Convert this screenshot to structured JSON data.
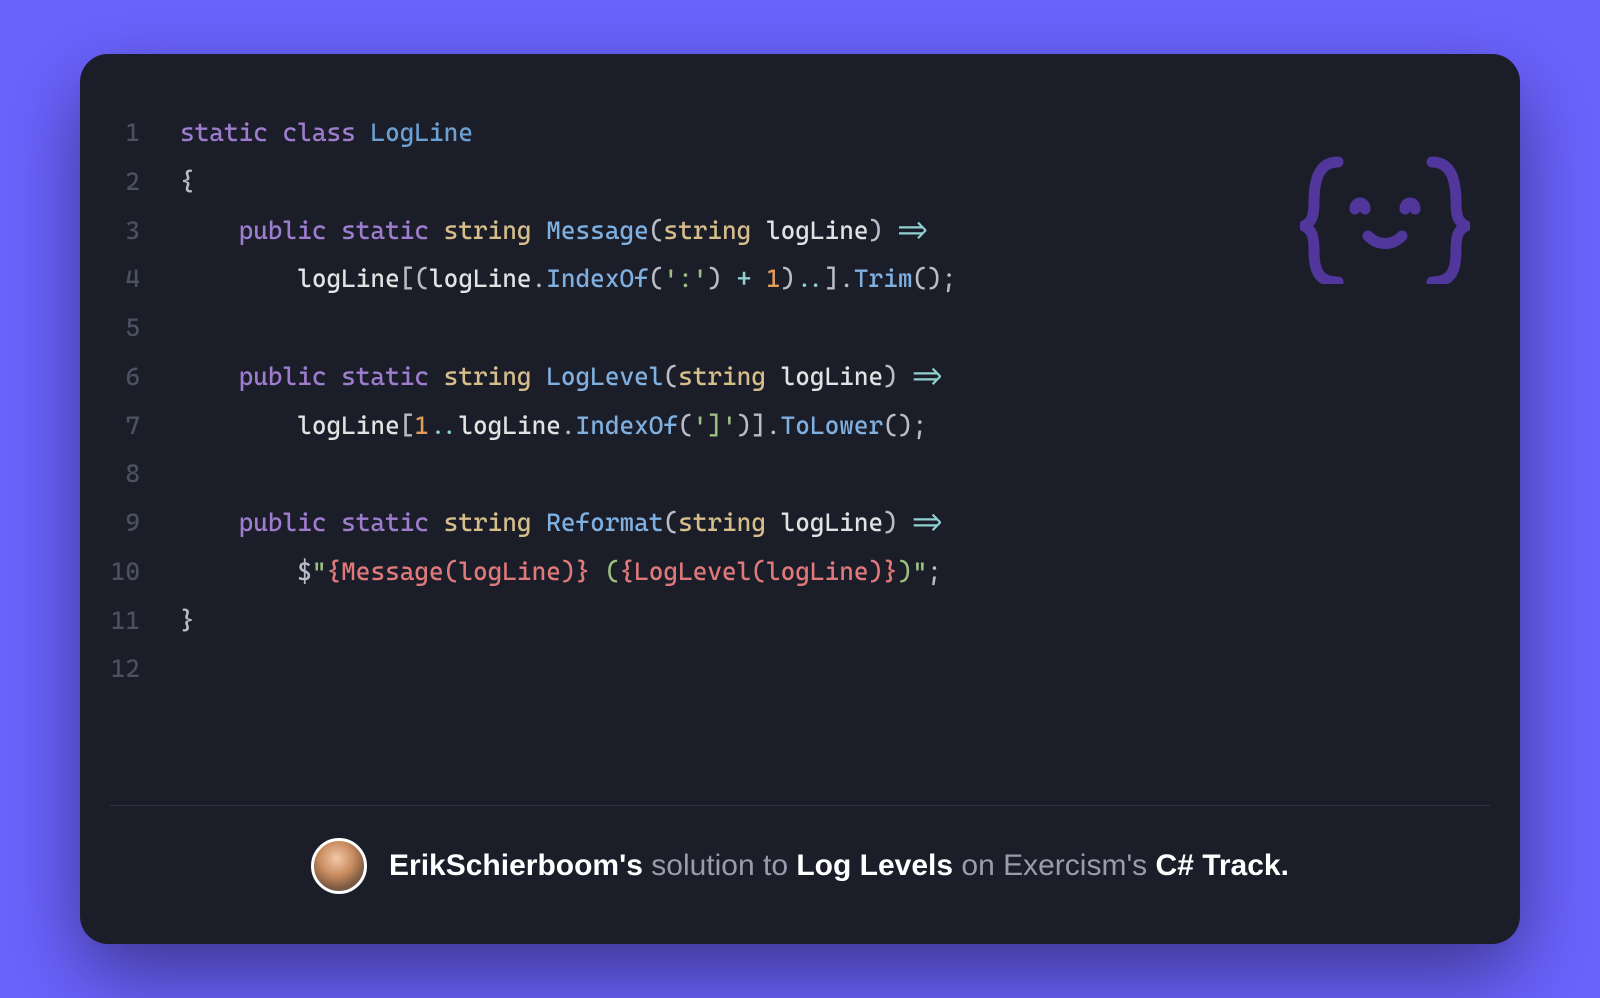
{
  "code": {
    "lines": [
      {
        "n": "1",
        "tokens": [
          [
            "kw",
            "static"
          ],
          [
            "",
            ""
          ],
          [
            "kw",
            " class"
          ],
          [
            "",
            ""
          ],
          [
            "cls",
            " LogLine"
          ]
        ]
      },
      {
        "n": "2",
        "tokens": [
          [
            "punc",
            "{"
          ]
        ]
      },
      {
        "n": "3",
        "tokens": [
          [
            "",
            "    "
          ],
          [
            "kw",
            "public"
          ],
          [
            "kw",
            " static"
          ],
          [
            "typ",
            " string"
          ],
          [
            "fn",
            " Message"
          ],
          [
            "punc",
            "("
          ],
          [
            "typ",
            "string"
          ],
          [
            "id",
            " logLine"
          ],
          [
            "punc",
            ")"
          ],
          [
            "op",
            " =>"
          ]
        ]
      },
      {
        "n": "4",
        "tokens": [
          [
            "",
            "        "
          ],
          [
            "id",
            "logLine"
          ],
          [
            "punc",
            "[("
          ],
          [
            "id",
            "logLine"
          ],
          [
            "punc",
            "."
          ],
          [
            "fn",
            "IndexOf"
          ],
          [
            "punc",
            "("
          ],
          [
            "str",
            "':'"
          ],
          [
            "punc",
            ")"
          ],
          [
            "op",
            " + "
          ],
          [
            "num",
            "1"
          ],
          [
            "punc",
            ")"
          ],
          [
            "op",
            ".."
          ],
          [
            "punc",
            "]."
          ],
          [
            "fn",
            "Trim"
          ],
          [
            "punc",
            "();"
          ]
        ]
      },
      {
        "n": "5",
        "tokens": [
          [
            "",
            ""
          ]
        ]
      },
      {
        "n": "6",
        "tokens": [
          [
            "",
            "    "
          ],
          [
            "kw",
            "public"
          ],
          [
            "kw",
            " static"
          ],
          [
            "typ",
            " string"
          ],
          [
            "fn",
            " LogLevel"
          ],
          [
            "punc",
            "("
          ],
          [
            "typ",
            "string"
          ],
          [
            "id",
            " logLine"
          ],
          [
            "punc",
            ")"
          ],
          [
            "op",
            " =>"
          ]
        ]
      },
      {
        "n": "7",
        "tokens": [
          [
            "",
            "        "
          ],
          [
            "id",
            "logLine"
          ],
          [
            "punc",
            "["
          ],
          [
            "num",
            "1"
          ],
          [
            "op",
            ".."
          ],
          [
            "id",
            "logLine"
          ],
          [
            "punc",
            "."
          ],
          [
            "fn",
            "IndexOf"
          ],
          [
            "punc",
            "("
          ],
          [
            "str",
            "']'"
          ],
          [
            "punc",
            ")]."
          ],
          [
            "fn",
            "ToLower"
          ],
          [
            "punc",
            "();"
          ]
        ]
      },
      {
        "n": "8",
        "tokens": [
          [
            "",
            ""
          ]
        ]
      },
      {
        "n": "9",
        "tokens": [
          [
            "",
            "    "
          ],
          [
            "kw",
            "public"
          ],
          [
            "kw",
            " static"
          ],
          [
            "typ",
            " string"
          ],
          [
            "fn",
            " Reformat"
          ],
          [
            "punc",
            "("
          ],
          [
            "typ",
            "string"
          ],
          [
            "id",
            " logLine"
          ],
          [
            "punc",
            ")"
          ],
          [
            "op",
            " =>"
          ]
        ]
      },
      {
        "n": "10",
        "tokens": [
          [
            "",
            "        "
          ],
          [
            "punc",
            "$"
          ],
          [
            "str",
            "\""
          ],
          [
            "intp",
            "{Message(logLine)}"
          ],
          [
            "str",
            " ("
          ],
          [
            "intp",
            "{LogLevel(logLine)}"
          ],
          [
            "str",
            ")\""
          ],
          [
            "punc",
            ";"
          ]
        ]
      },
      {
        "n": "11",
        "tokens": [
          [
            "punc",
            "}"
          ]
        ]
      },
      {
        "n": "12",
        "tokens": [
          [
            "",
            ""
          ]
        ]
      }
    ]
  },
  "attribution": {
    "author": "ErikSchierboom's",
    "word_solution": " solution to ",
    "exercise": "Log Levels",
    "word_on": " on Exercism's ",
    "track": "C# Track."
  }
}
